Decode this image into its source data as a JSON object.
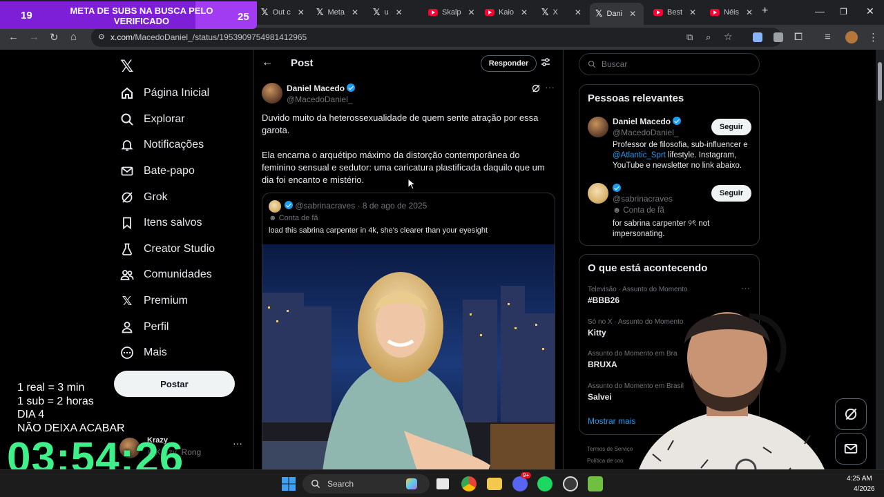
{
  "browser": {
    "tabs": [
      {
        "label": "Out c",
        "icon": "x-icon"
      },
      {
        "label": "Meta",
        "icon": "x-icon"
      },
      {
        "label": "u",
        "icon": "x-icon"
      },
      {
        "label": "Skalp",
        "icon": "youtube-icon"
      },
      {
        "label": "Kaio",
        "icon": "youtube-icon"
      },
      {
        "label": "X",
        "icon": "x-icon"
      },
      {
        "label": "Dani",
        "icon": "x-icon",
        "active": true
      },
      {
        "label": "Best",
        "icon": "youtube-icon"
      },
      {
        "label": "Néis",
        "icon": "youtube-icon"
      }
    ],
    "url_host": "x.com",
    "url_path": "/MacedoDaniel_/status/1953909754981412965"
  },
  "sub_goal": {
    "left_count": "19",
    "right_count": "25",
    "title": "META DE SUBS NA BUSCA PELO VERIFICADO",
    "progress": 0.76,
    "color": "#a23cf2"
  },
  "nav": {
    "items": [
      {
        "label": "Página Inicial",
        "icon": "home-icon"
      },
      {
        "label": "Explorar",
        "icon": "search-icon"
      },
      {
        "label": "Notificações",
        "icon": "bell-icon"
      },
      {
        "label": "Bate-papo",
        "icon": "mail-icon"
      },
      {
        "label": "Grok",
        "icon": "grok-icon"
      },
      {
        "label": "Itens salvos",
        "icon": "bookmark-icon"
      },
      {
        "label": "Creator Studio",
        "icon": "flask-icon"
      },
      {
        "label": "Comunidades",
        "icon": "people-icon"
      },
      {
        "label": "Premium",
        "icon": "x-icon"
      },
      {
        "label": "Perfil",
        "icon": "person-icon"
      },
      {
        "label": "Mais",
        "icon": "more-circle-icon"
      }
    ],
    "post_label": "Postar",
    "account_name": "Krazy",
    "account_handle": "@Krazy_Rong"
  },
  "post": {
    "header_title": "Post",
    "reply_label": "Responder",
    "author_name": "Daniel Macedo",
    "author_handle": "@MacedoDaniel_",
    "text_1": "Duvido muito da heterossexualidade de quem sente atração por essa garota.",
    "text_2": "Ela encarna o arquétipo máximo da distorção contemporânea do feminino sensual e sedutor: uma caricatura plastificada daquilo que um dia foi encanto e mistério.",
    "quote": {
      "handle": "@sabrinacraves",
      "date": "· 8 de ago de 2025",
      "tag": "Conta de fã",
      "text": "load this sabrina carpenter in 4k, she's clearer than your eyesight"
    }
  },
  "right": {
    "search_placeholder": "Buscar",
    "relevant_title": "Pessoas relevantes",
    "people": [
      {
        "name": "Daniel Macedo",
        "handle": "@MacedoDaniel_",
        "follow": "Seguir",
        "bio_pre": "Professor de filosofia, sub-influencer e ",
        "bio_link": "@Atlantic_Sprt",
        "bio_post": " lifestyle. Instagram, YouTube e newsletter no link abaixo."
      },
      {
        "name": "",
        "handle": "@sabrinacraves",
        "tag": "Conta de fã",
        "follow": "Seguir",
        "bio": "for sabrina carpenter ୨ৎ not impersonating."
      }
    ],
    "trends_title": "O que está acontecendo",
    "trends": [
      {
        "meta": "Televisão · Assunto do Momento",
        "name": "#BBB26"
      },
      {
        "meta": "Só no X · Assunto do Momento",
        "name": "Kitty"
      },
      {
        "meta": "Assunto do Momento em Bra",
        "name": "BRUXA"
      },
      {
        "meta": "Assunto do Momento em Brasil",
        "name": "Salvei"
      }
    ],
    "show_more": "Mostrar mais",
    "footer_1": "Termos de Serviço",
    "footer_2": "Política de coo"
  },
  "overlay": {
    "line1": "1 real = 3 min",
    "line2": "1 sub = 2 horas",
    "line3": "DIA 4",
    "line4": "NÃO DEIXA ACABAR",
    "timer": "03:54:26"
  },
  "taskbar": {
    "search_label": "Search",
    "time": "4:25 AM",
    "date": "4/2026",
    "discord_badge": "9+"
  }
}
